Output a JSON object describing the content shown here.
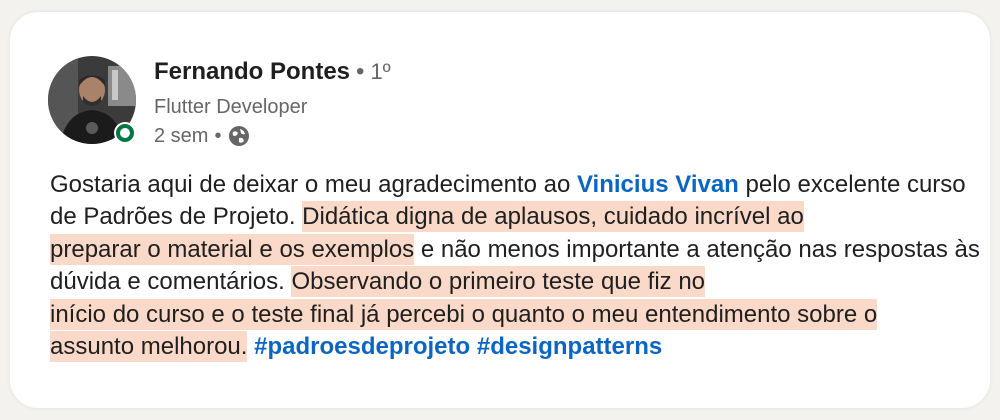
{
  "author": {
    "name": "Fernando Pontes",
    "degree": "1º",
    "headline": "Flutter Developer",
    "time_ago": "2 sem"
  },
  "icons": {
    "avatar": "profile-photo",
    "presence": "online-status-icon",
    "visibility": "globe-icon"
  },
  "colors": {
    "link": "#0a66c2",
    "highlight": "#fbd9c8",
    "online": "#057642"
  },
  "post": {
    "text_1": "Gostaria aqui de deixar o meu agradecimento ao ",
    "mention": "Vinicius Vivan",
    "text_2": " pelo excelente curso de Padrões de Projeto. ",
    "highlight_1a": "Didática digna de aplausos, cuidado incrível ao",
    "highlight_1b": "preparar o material e os exemplos",
    "text_3": " e não menos importante a atenção nas respostas às dúvida e comentários. ",
    "highlight_2a": "Observando o primeiro teste que fiz no",
    "highlight_2b": "início do curso e o teste final já percebi o quanto o meu entendimento sobre o",
    "highlight_2c": "assunto melhorou.",
    "hashtag_1": "#padroesdeprojeto",
    "hashtag_2": "#designpatterns"
  }
}
